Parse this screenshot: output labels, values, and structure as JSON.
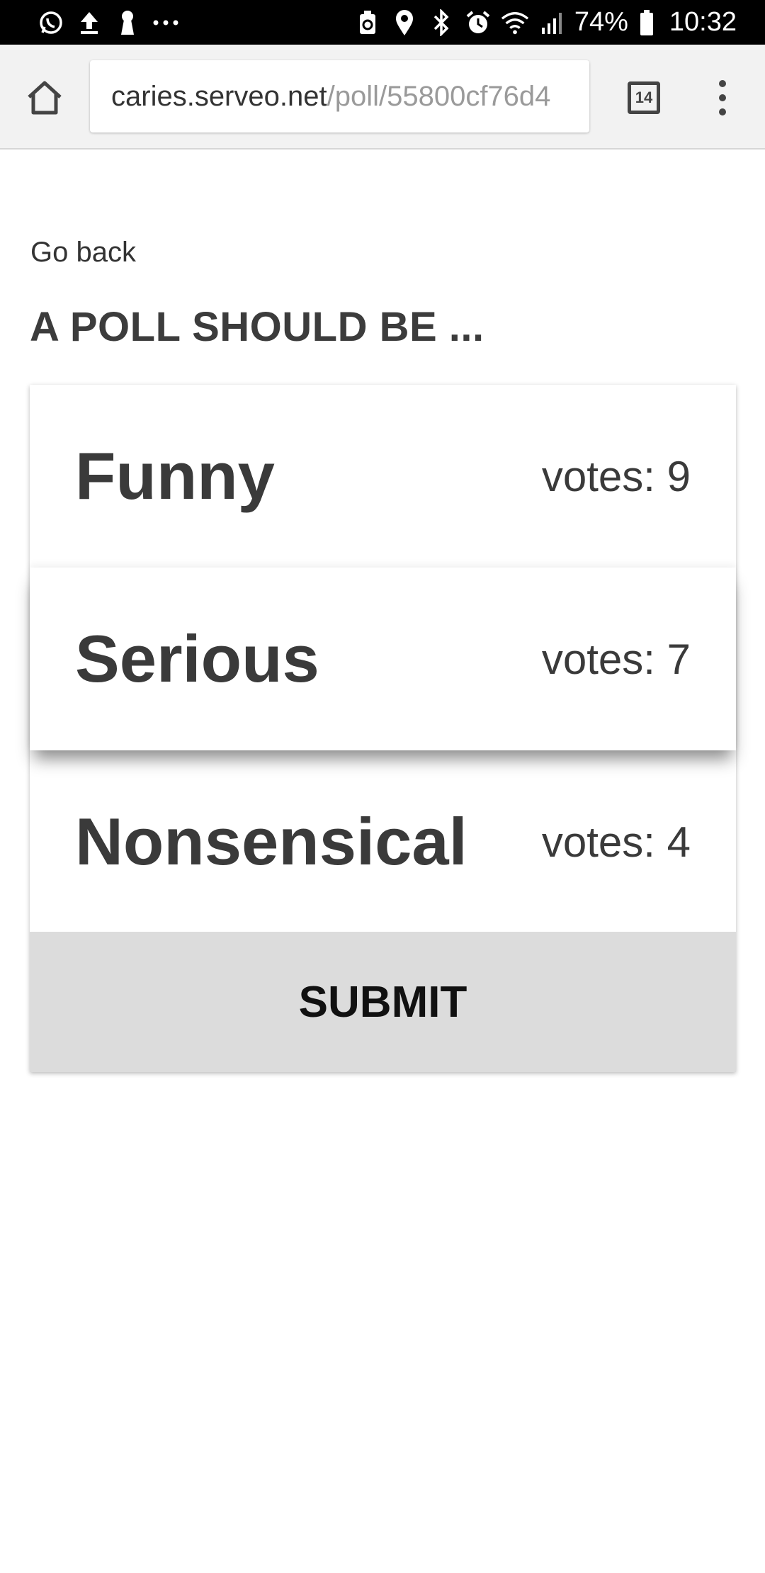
{
  "status_bar": {
    "battery_percent": "74%",
    "time": "10:32",
    "left_icons": [
      "whatsapp-icon",
      "upload-icon",
      "keyhole-icon",
      "more-dots-icon"
    ],
    "right_icons": [
      "battery-saver-icon",
      "location-icon",
      "bluetooth-icon",
      "alarm-icon",
      "wifi-icon",
      "signal-icon",
      "battery-icon"
    ]
  },
  "browser": {
    "url_host": "caries.serveo.net",
    "url_path": "/poll/55800cf76d4",
    "tab_count": "14"
  },
  "page": {
    "go_back": "Go back",
    "title": "A POLL SHOULD BE ...",
    "options": [
      {
        "label": "Funny",
        "votes": "votes: 9"
      },
      {
        "label": "Serious",
        "votes": "votes: 7"
      },
      {
        "label": "Nonsensical",
        "votes": "votes: 4"
      }
    ],
    "submit_label": "SUBMIT"
  }
}
